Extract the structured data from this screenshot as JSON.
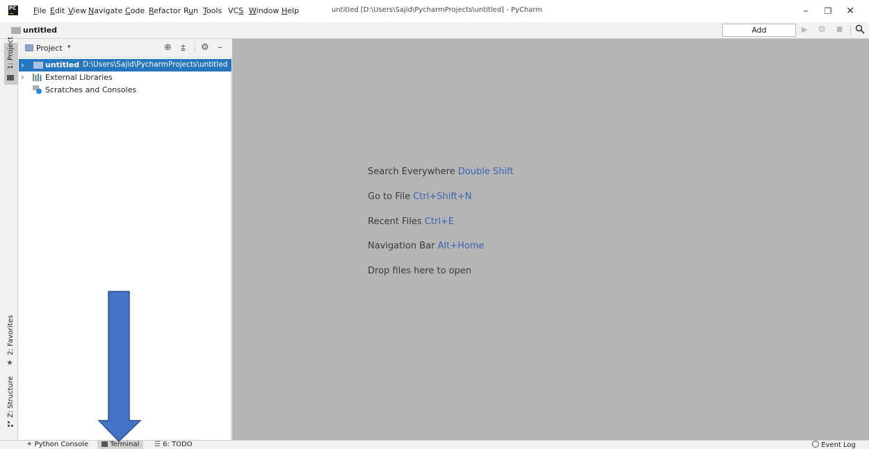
{
  "app": {
    "logo_text": "PC",
    "window_title": "untitled [D:\\Users\\Sajid\\PycharmProjects\\untitled] - PyCharm"
  },
  "menu": [
    {
      "label": "File",
      "mnemonic": "F",
      "rest": "ile"
    },
    {
      "label": "Edit",
      "mnemonic": "E",
      "rest": "dit"
    },
    {
      "label": "View",
      "mnemonic": "V",
      "rest": "iew"
    },
    {
      "label": "Navigate",
      "mnemonic": "N",
      "rest": "avigate"
    },
    {
      "label": "Code",
      "mnemonic": "C",
      "rest": "ode"
    },
    {
      "label": "Refactor",
      "mnemonic": "R",
      "rest": "efactor"
    },
    {
      "label": "Run",
      "pre": "R",
      "mnemonic": "u",
      "rest": "n"
    },
    {
      "label": "Tools",
      "mnemonic": "T",
      "rest": "ools"
    },
    {
      "label": "VCS",
      "pre": "VC",
      "mnemonic": "S",
      "rest": ""
    },
    {
      "label": "Window",
      "mnemonic": "W",
      "rest": "indow"
    },
    {
      "label": "Help",
      "mnemonic": "H",
      "rest": "elp"
    }
  ],
  "window_controls": {
    "minimize": "–",
    "restore": "❐",
    "close": "✕"
  },
  "navbar": {
    "project_name": "untitled",
    "add_configuration": "Add Configuration...",
    "run_glyph": "▶",
    "debug_glyph": "❂",
    "stop_glyph": "■"
  },
  "left_stripe": {
    "project": "1: Project",
    "favorites": "2: Favorites",
    "structure": "Z: Structure",
    "favorites_glyph": "★"
  },
  "project_panel": {
    "view_label": "Project",
    "caret": "▾",
    "locate_glyph": "⊕",
    "collapse_glyph": "⩲",
    "settings_glyph": "⚙",
    "hide_glyph": "–",
    "tree": [
      {
        "name": "untitled",
        "path": "D:\\Users\\Sajid\\PycharmProjects\\untitled",
        "selected": true
      },
      {
        "name": "External Libraries"
      },
      {
        "name": "Scratches and Consoles"
      }
    ],
    "arrow_glyph": "›"
  },
  "editor_hints": [
    {
      "text": "Search Everywhere",
      "key": "Double Shift"
    },
    {
      "text": "Go to File",
      "key": "Ctrl+Shift+N"
    },
    {
      "text": "Recent Files",
      "key": "Ctrl+E"
    },
    {
      "text": "Navigation Bar",
      "key": "Alt+Home"
    },
    {
      "text": "Drop files here to open",
      "key": ""
    }
  ],
  "bottom_tools": {
    "python_console": "Python Console",
    "terminal": "Terminal",
    "todo": "6: TODO",
    "event_log": "Event Log"
  },
  "colors": {
    "selection": "#2675bf",
    "editor_bg": "#b5b5b5",
    "hint_key": "#3c64b4",
    "annotation_arrow": "#4472c4"
  }
}
